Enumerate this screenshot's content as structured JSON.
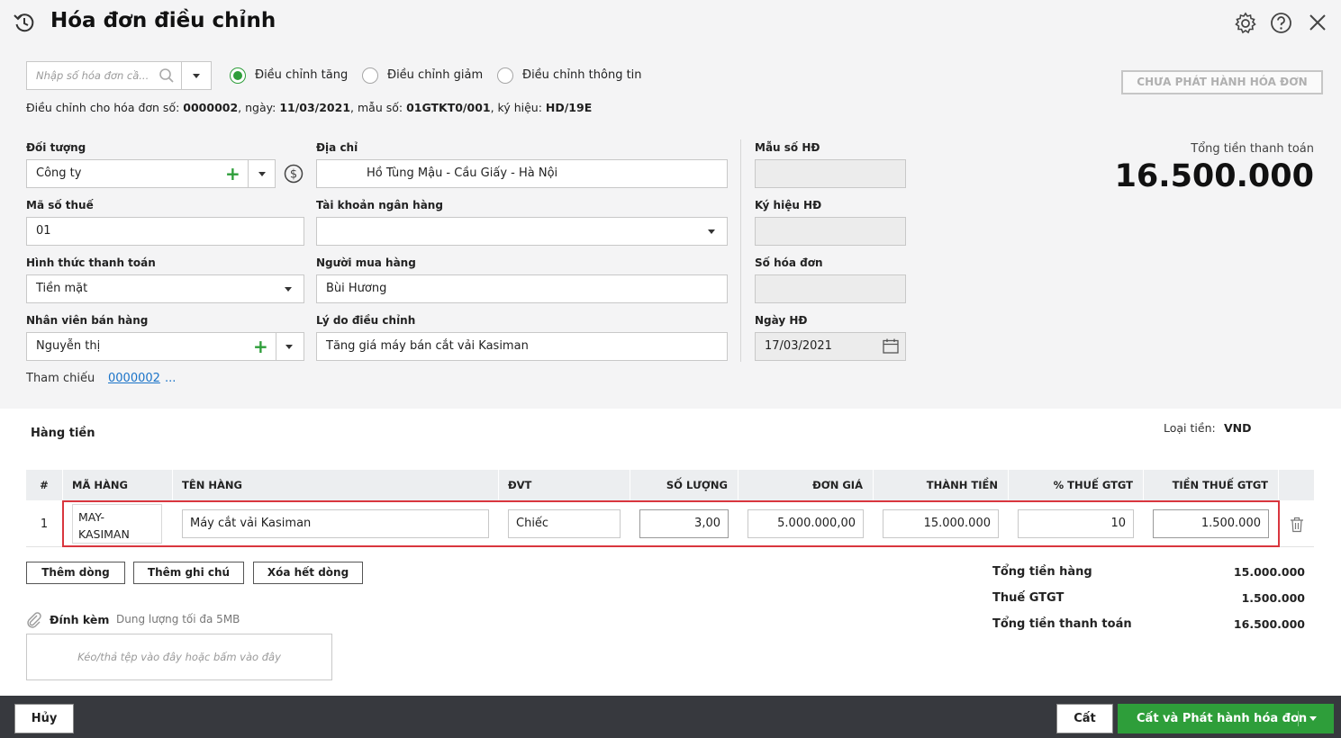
{
  "header": {
    "title": "Hóa đơn điều chỉnh"
  },
  "search": {
    "placeholder": "Nhập số hóa đơn cầ..."
  },
  "adjust_types": [
    {
      "label": "Điều chỉnh tăng",
      "selected": true
    },
    {
      "label": "Điều chỉnh giảm",
      "selected": false
    },
    {
      "label": "Điều chỉnh thông tin",
      "selected": false
    }
  ],
  "status_button": "CHƯA PHÁT HÀNH HÓA ĐƠN",
  "adjust_info": {
    "prefix": "Điều chỉnh cho hóa đơn số: ",
    "invoice_no": "0000002",
    "date_label": ", ngày: ",
    "date": "11/03/2021",
    "template_label": ", mẫu số: ",
    "template": "01GTKT0/001",
    "symbol_label": ", ký hiệu: ",
    "symbol": "HD/19E"
  },
  "form": {
    "doi_tuong": {
      "label": "Đối tượng",
      "value": "Công ty"
    },
    "dia_chi": {
      "label": "Địa chỉ",
      "value": "Hồ Tùng Mậu - Cầu Giấy - Hà Nội"
    },
    "ma_so_thue": {
      "label": "Mã số thuế",
      "value": "01"
    },
    "tai_khoan": {
      "label": "Tài khoản ngân hàng",
      "value": ""
    },
    "hinh_thuc": {
      "label": "Hình thức thanh toán",
      "value": "Tiền mặt"
    },
    "nguoi_mua": {
      "label": "Người mua hàng",
      "value": "Bùi Hương"
    },
    "nhan_vien": {
      "label": "Nhân viên bán hàng",
      "value": "Nguyễn thị"
    },
    "ly_do": {
      "label": "Lý do điều chỉnh",
      "value": "Tăng giá máy bán cắt vải Kasiman"
    },
    "mau_so": {
      "label": "Mẫu số HĐ",
      "value": ""
    },
    "ky_hieu": {
      "label": "Ký hiệu HĐ",
      "value": ""
    },
    "so_hoa_don": {
      "label": "Số hóa đơn",
      "value": ""
    },
    "ngay_hd": {
      "label": "Ngày HĐ",
      "value": "17/03/2021"
    },
    "tham_chieu": {
      "label": "Tham chiếu",
      "link": "0000002",
      "more": "..."
    }
  },
  "total_box": {
    "label": "Tổng tiền thanh toán",
    "value": "16.500.000"
  },
  "items_section": {
    "title": "Hàng tiền",
    "currency_label": "Loại tiền:",
    "currency": "VND"
  },
  "table": {
    "columns": [
      "#",
      "MÃ HÀNG",
      "TÊN HÀNG",
      "ĐVT",
      "SỐ LƯỢNG",
      "ĐƠN GIÁ",
      "THÀNH TIỀN",
      "% THUẾ GTGT",
      "TIỀN THUẾ GTGT"
    ],
    "rows": [
      {
        "idx": "1",
        "code_line1": "MAY-",
        "code_line2": "KASIMAN",
        "name": "Máy cắt vải Kasiman",
        "unit": "Chiếc",
        "qty": "3,00",
        "price": "5.000.000,00",
        "amount": "15.000.000",
        "vat_pct": "10",
        "vat_amount": "1.500.000"
      }
    ]
  },
  "table_actions": {
    "add_row": "Thêm dòng",
    "add_note": "Thêm ghi chú",
    "clear_rows": "Xóa hết dòng"
  },
  "summary": [
    {
      "label": "Tổng tiền hàng",
      "value": "15.000.000"
    },
    {
      "label": "Thuế GTGT",
      "value": "1.500.000"
    },
    {
      "label": "Tổng tiền thanh toán",
      "value": "16.500.000"
    }
  ],
  "attachment": {
    "label": "Đính kèm",
    "limit": "Dung lượng tối đa 5MB",
    "dropzone": "Kéo/thả tệp vào đây hoặc bấm vào đây"
  },
  "footer": {
    "cancel": "Hủy",
    "save": "Cất",
    "save_publish": "Cất và Phát hành hóa đơn"
  },
  "colors": {
    "accent": "#2e9e3a",
    "highlight": "#d9363e",
    "link": "#1a73c8",
    "footer_bg": "#37393e"
  }
}
